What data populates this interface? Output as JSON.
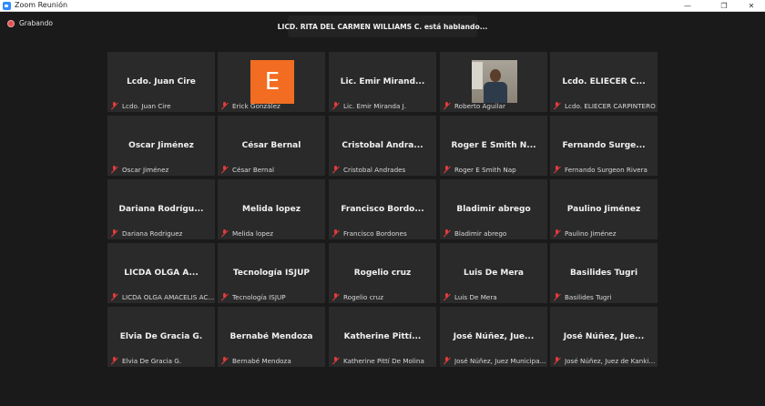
{
  "window": {
    "title": "Zoom Reunión",
    "minimize": "—",
    "maximize": "❐",
    "close": "✕"
  },
  "recording": {
    "label": "Grabando"
  },
  "speaking_banner": "LICD. RITA DEL CARMEN WILLIAMS C. está hablando...",
  "tiles": [
    {
      "big": "Lcdo. Juan Cire",
      "small": "Lcdo. Juan Cire"
    },
    {
      "big": "",
      "avatar": "E",
      "small": "Erick González"
    },
    {
      "big": "Lic. Emir Mirand...",
      "small": "Lic. Emir Miranda J."
    },
    {
      "big": "",
      "photo": true,
      "small": "Roberto Aguilar"
    },
    {
      "big": "Lcdo. ELIECER C...",
      "small": "Lcdo. ELIECER CARPINTERO"
    },
    {
      "big": "Oscar Jiménez",
      "small": "Oscar Jiménez"
    },
    {
      "big": "César Bernal",
      "small": "César Bernal"
    },
    {
      "big": "Cristobal Andra...",
      "small": "Cristobal Andrades"
    },
    {
      "big": "Roger E Smith N...",
      "small": "Roger E Smith Nap"
    },
    {
      "big": "Fernando Surge...",
      "small": "Fernando Surgeon Rivera"
    },
    {
      "big": "Dariana Rodrígu...",
      "small": "Dariana Rodriguez"
    },
    {
      "big": "Melida lopez",
      "small": "Melida lopez"
    },
    {
      "big": "Francisco Bordo...",
      "small": "Francisco Bordones"
    },
    {
      "big": "Bladimir abrego",
      "small": "Bladimir abrego"
    },
    {
      "big": "Paulino Jiménez",
      "small": "Paulino Jiménez"
    },
    {
      "big": "LICDA OLGA A...",
      "small": "LICDA OLGA AMACELIS AC..."
    },
    {
      "big": "Tecnología ISJUP",
      "small": "Tecnología ISJUP"
    },
    {
      "big": "Rogelio cruz",
      "small": "Rogelio cruz"
    },
    {
      "big": "Luis De Mera",
      "small": "Luis De Mera"
    },
    {
      "big": "Basilides Tugri",
      "small": "Basilides Tugri"
    },
    {
      "big": "Elvia De Gracia G.",
      "small": "Elvia De Gracia G."
    },
    {
      "big": "Bernabé Mendoza",
      "small": "Bernabé Mendoza"
    },
    {
      "big": "Katherine Pittí...",
      "small": "Katherine Pittí De Molina"
    },
    {
      "big": "José Núñez, Jue...",
      "small": "José Núñez, Juez Municipa..."
    },
    {
      "big": "José Núñez, Jue...",
      "small": "José Núñez, Juez de Kankintú"
    }
  ]
}
